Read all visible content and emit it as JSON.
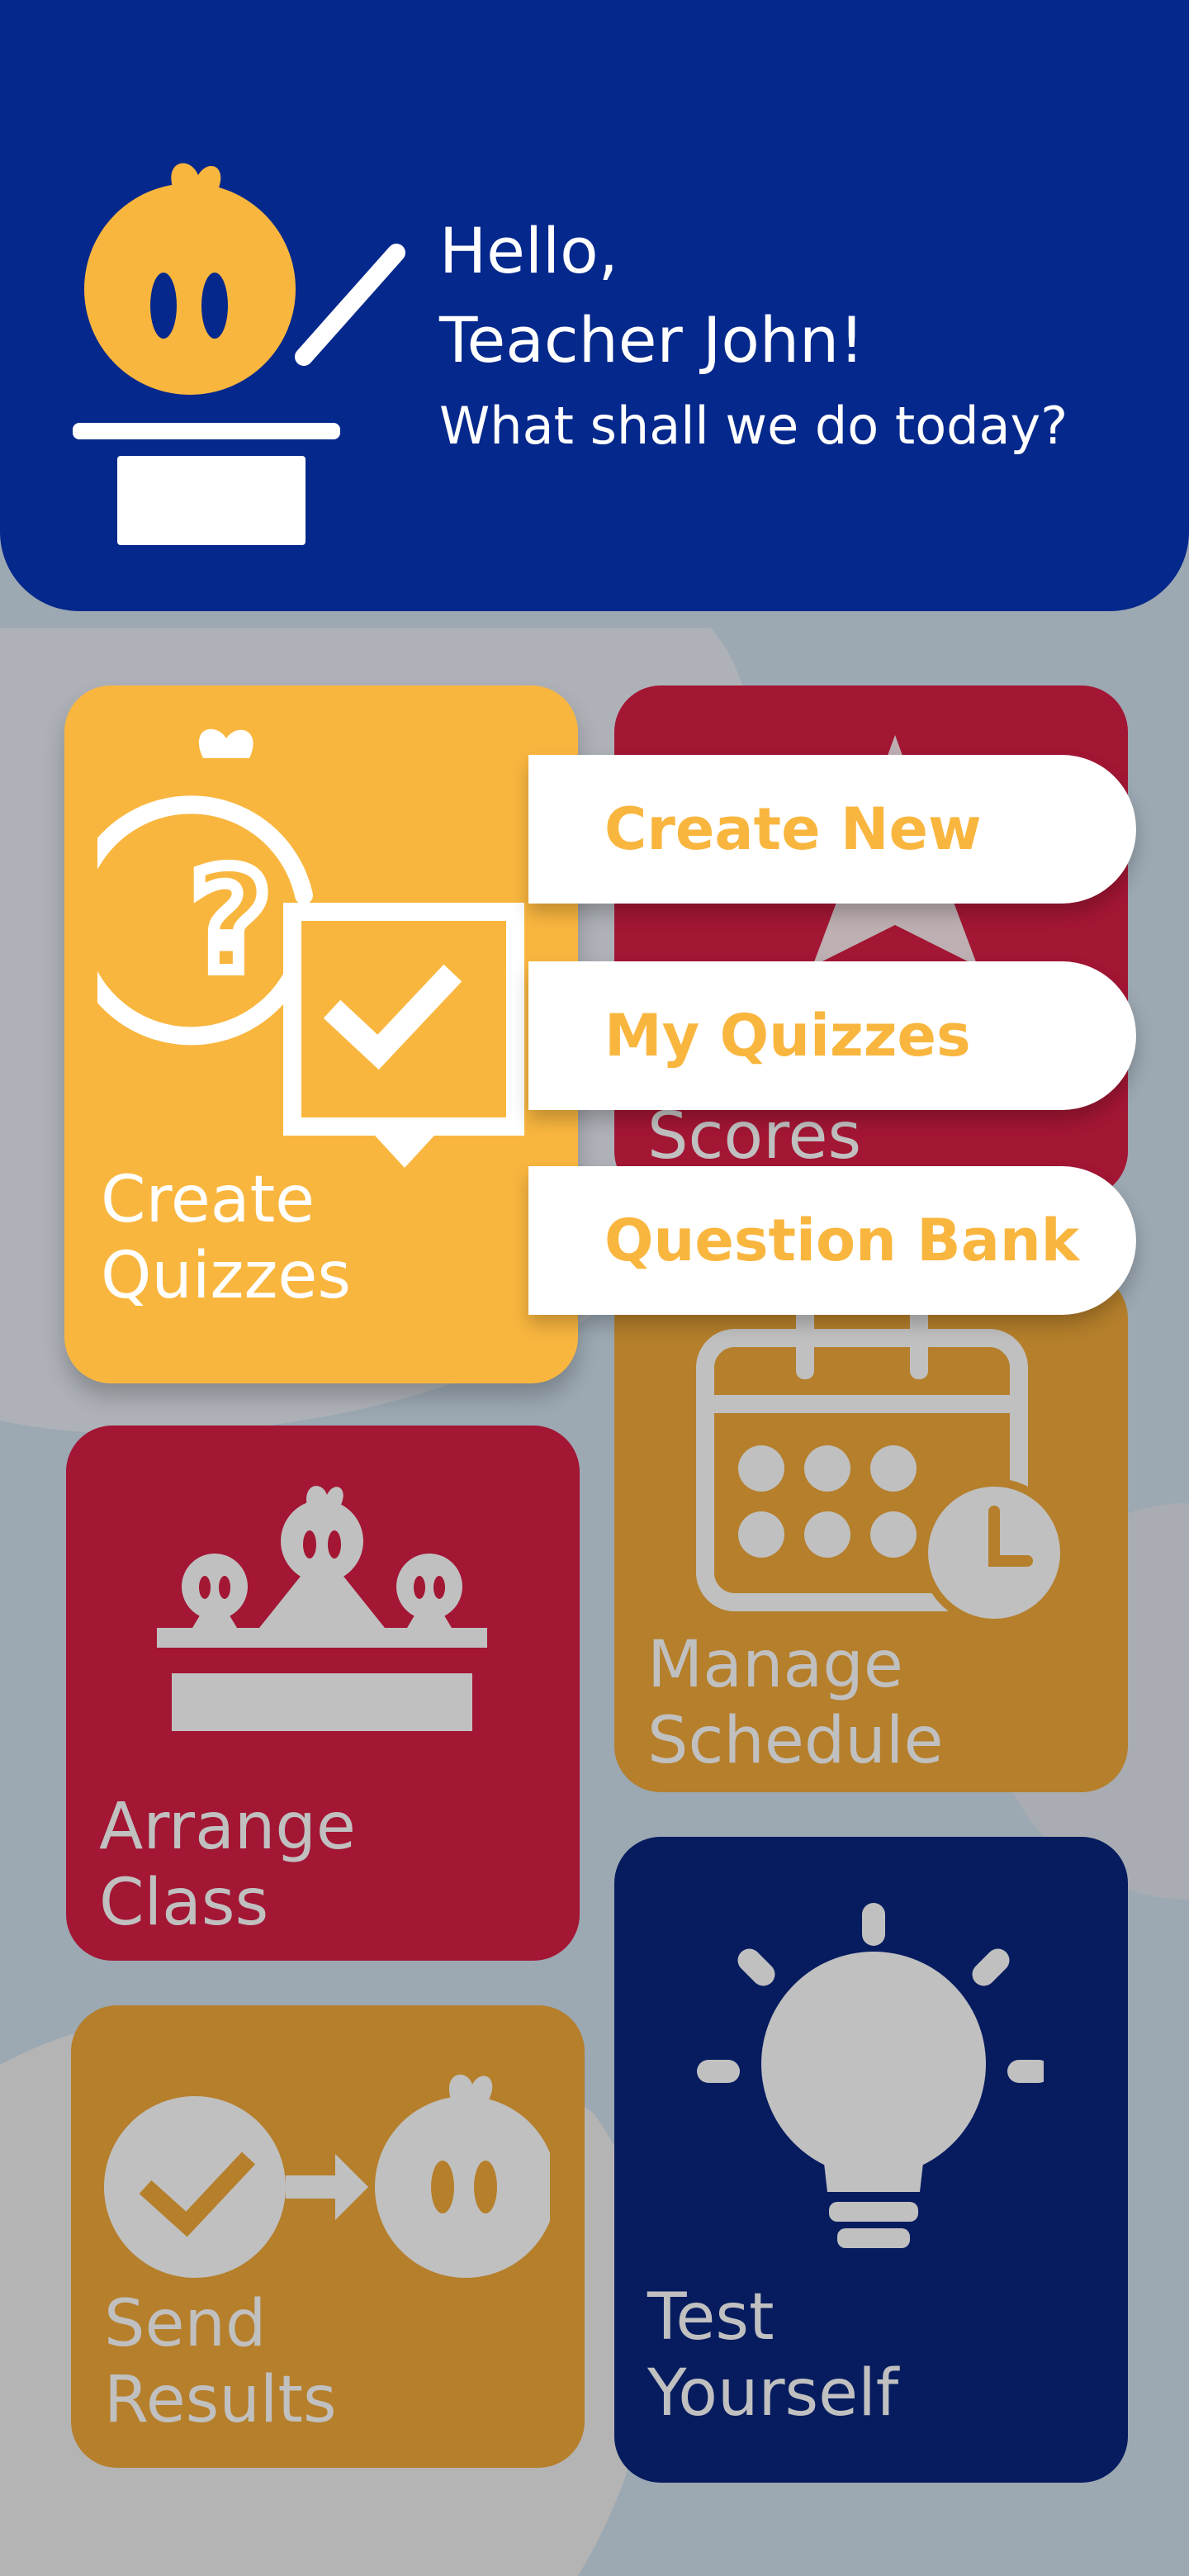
{
  "header": {
    "greeting_line1": "Hello,",
    "greeting_line2": "Teacher John!",
    "subtitle": "What shall we do today?"
  },
  "tiles": {
    "create_quizzes": "Create\nQuizzes",
    "scores_visible_fragment": "Scores",
    "manage_schedule": "Manage\nSchedule",
    "arrange_class": "Arrange\nClass",
    "send_results": "Send\nResults",
    "test_yourself": "Test\nYourself"
  },
  "quiz_menu": {
    "create_new": "Create New",
    "my_quizzes": "My Quizzes",
    "question_bank": "Question Bank"
  },
  "colors": {
    "header_blue": "#05288c",
    "accent_yellow": "#f9b63f",
    "crimson": "#a31634",
    "mustard": "#b57f2b",
    "navy": "#061c5f",
    "muted_gray": "#c0c0c0",
    "background": "#9ca8b2"
  },
  "icons": {
    "header": "teacher-mascot-icon",
    "create_quizzes": "quiz-question-check-icon",
    "scores": "star-icon",
    "manage_schedule": "calendar-clock-icon",
    "arrange_class": "students-on-stage-icon",
    "send_results": "check-arrow-mascot-icon",
    "test_yourself": "lightbulb-icon"
  }
}
